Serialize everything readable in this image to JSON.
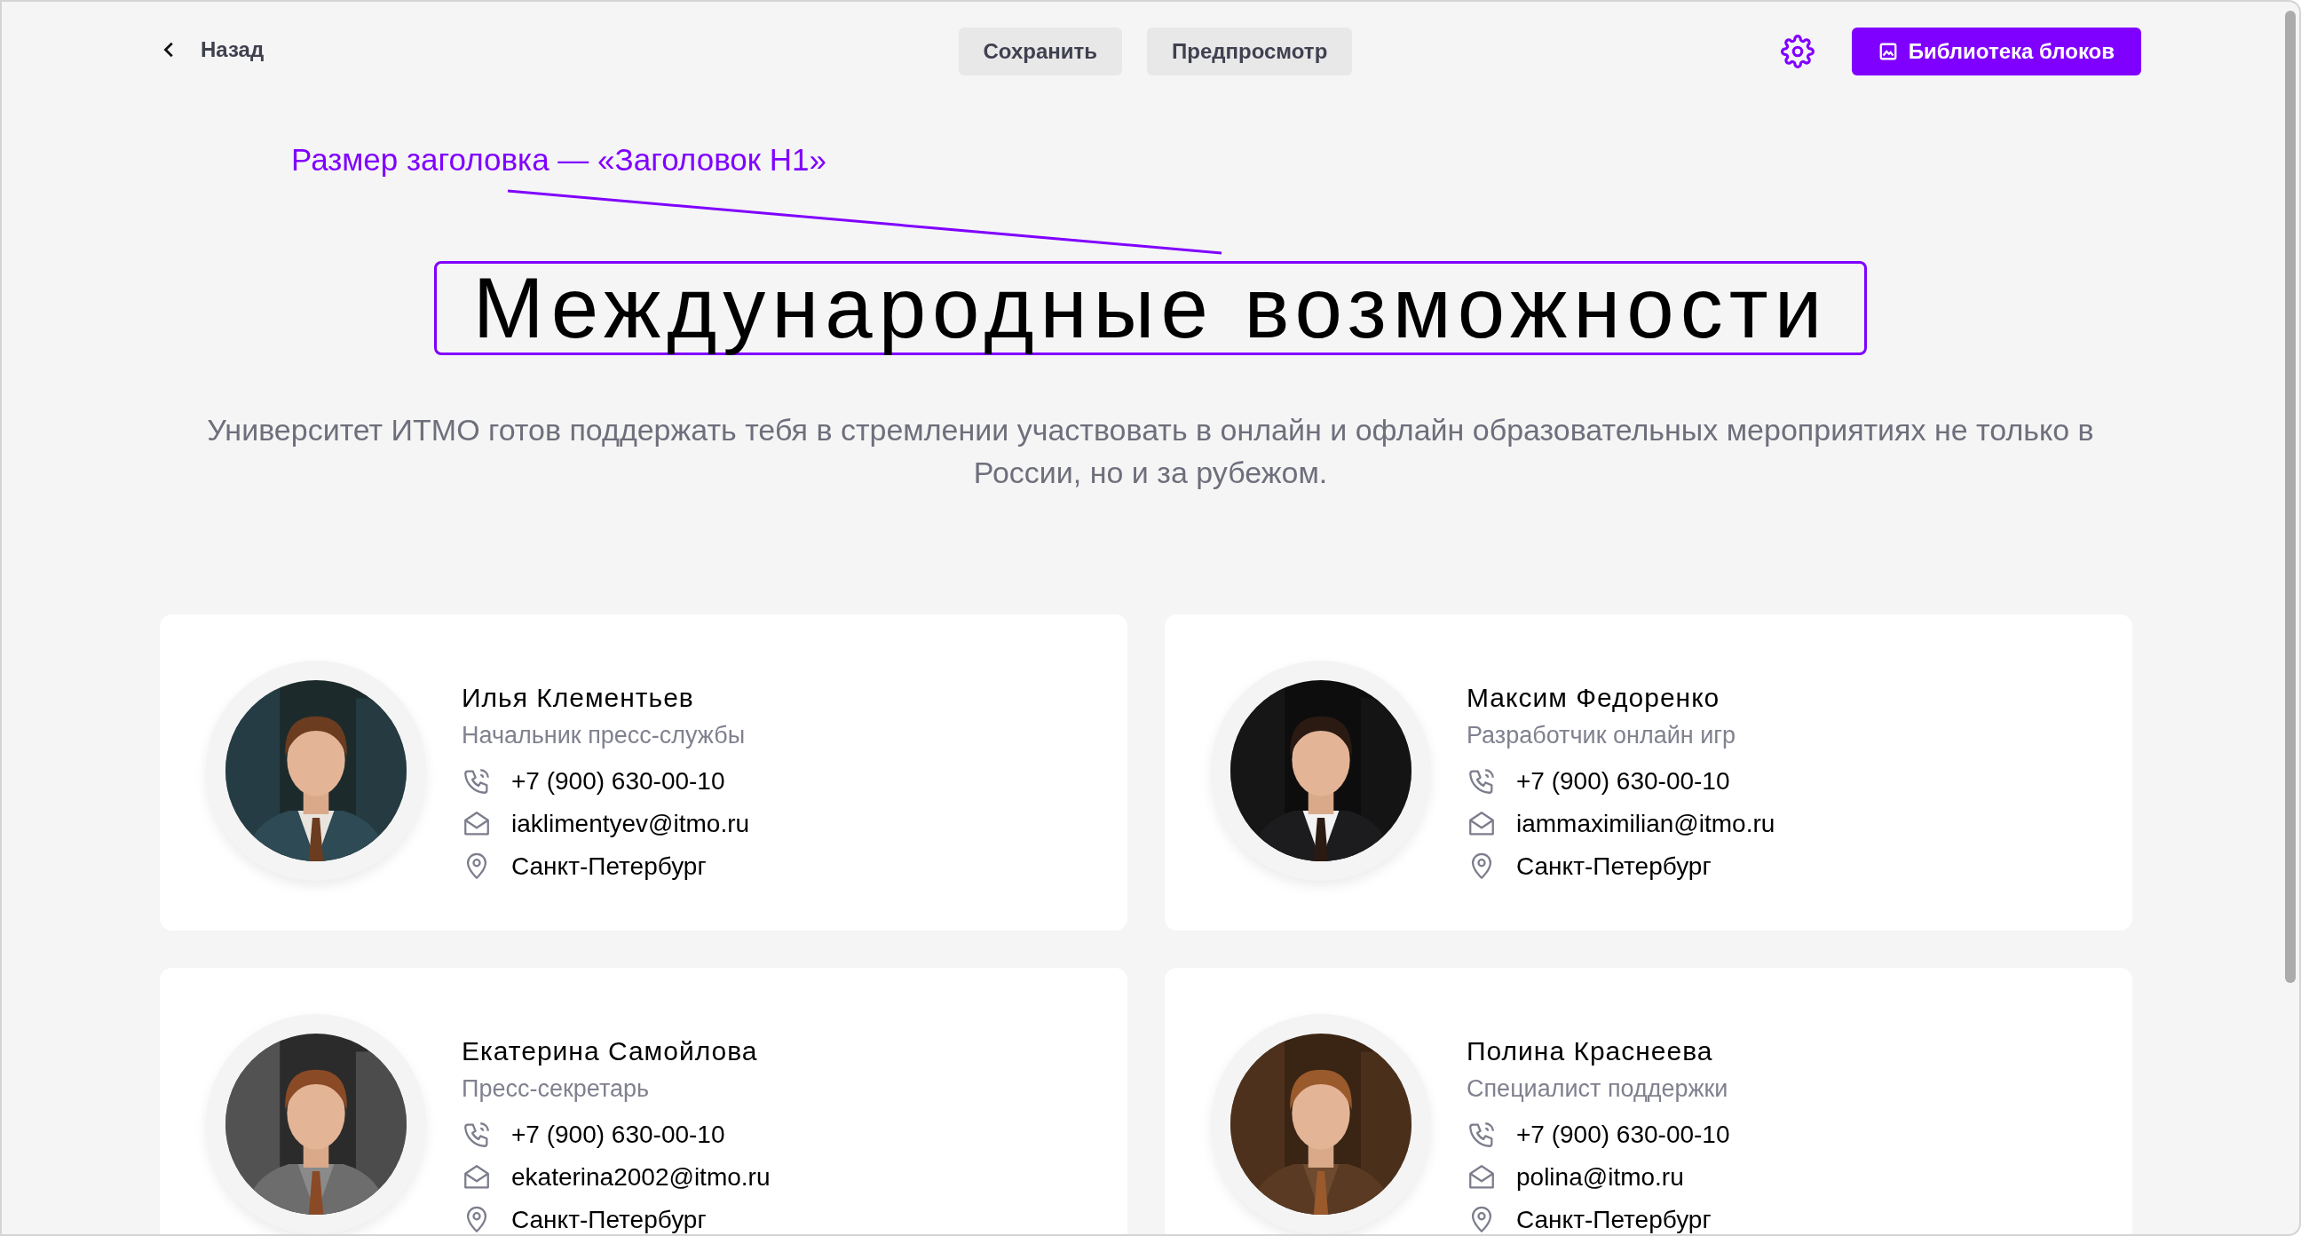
{
  "toolbar": {
    "back": "Назад",
    "buttons": [
      "Сохранить",
      "Предпросмотр"
    ],
    "library_button": "Библиотека блоков"
  },
  "annotation": "Размер заголовка — «Заголовок H1»",
  "heading": {
    "text": "Международные возможности",
    "selected": true
  },
  "subtitle": "Университет ИТМО готов поддержать тебя в стремлении участвовать в онлайн и офлайн образовательных мероприятиях не только в России, но и за рубежом.",
  "contacts": [
    {
      "name": "Илья Клементьев",
      "role": "Начальник пресс-службы",
      "phone": "+7 (900) 630-00-10",
      "email": "iaklimentyev@itmo.ru",
      "city": "Санкт-Петербург"
    },
    {
      "name": "Максим Федоренко",
      "role": "Разработчик онлайн игр",
      "phone": "+7 (900) 630-00-10",
      "email": "iammaximilian@itmo.ru",
      "city": "Санкт-Петербург"
    },
    {
      "name": "Екатерина Самойлова",
      "role": "Пресс-секретарь",
      "phone": "+7 (900) 630-00-10",
      "email": "ekaterina2002@itmo.ru",
      "city": "Санкт-Петербург"
    },
    {
      "name": "Полина Краснеева",
      "role": "Специалист поддержки",
      "phone": "+7 (900) 630-00-10",
      "email": "polina@itmo.ru",
      "city": "Санкт-Петербург"
    }
  ]
}
